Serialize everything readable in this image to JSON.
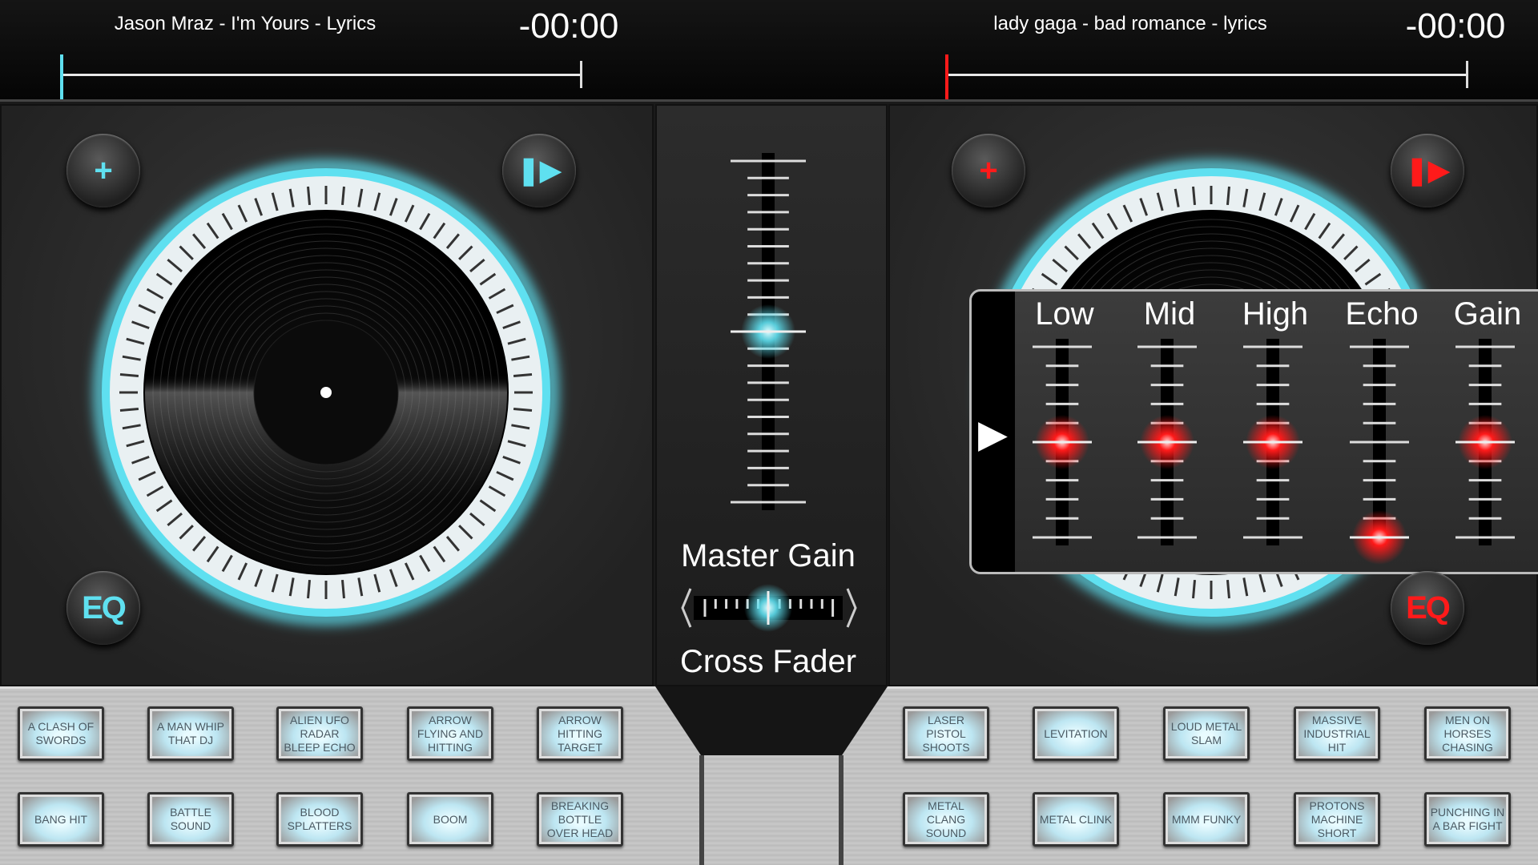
{
  "deck_left": {
    "track_title": "Jason Mraz - I'm Yours - Lyrics",
    "time": "-00:00",
    "progress": 0,
    "accent": "#5fe0f0",
    "add_icon": "plus-icon",
    "play_icon": "play-icon",
    "eq_label": "EQ"
  },
  "deck_right": {
    "track_title": "lady gaga - bad romance - lyrics",
    "time": "-00:00",
    "progress": 0,
    "accent": "#ff1a1a",
    "add_icon": "plus-icon",
    "play_icon": "play-icon",
    "eq_label": "EQ"
  },
  "mixer": {
    "master_gain_label": "Master Gain",
    "master_gain_level": 0.5,
    "cross_fader_label": "Cross Fader",
    "cross_fader_position": 0.5
  },
  "eq_panel": {
    "sliders": [
      {
        "label": "Low",
        "level": 0.5
      },
      {
        "label": "Mid",
        "level": 0.5
      },
      {
        "label": "High",
        "level": 0.5
      },
      {
        "label": "Echo",
        "level": 0
      },
      {
        "label": "Gain",
        "level": 0.5
      }
    ]
  },
  "pads_left": [
    "A CLASH OF SWORDS",
    "A MAN WHIP THAT DJ",
    "ALIEN UFO RADAR BLEEP ECHO",
    "ARROW FLYING AND HITTING",
    "ARROW HITTING TARGET",
    "BANG HIT",
    "BATTLE SOUND",
    "BLOOD SPLATTERS",
    "BOOM",
    "BREAKING BOTTLE OVER HEAD"
  ],
  "pads_right": [
    "LASER PISTOL SHOOTS",
    "LEVITATION",
    "LOUD METAL SLAM",
    "MASSIVE INDUSTRIAL HIT",
    "MEN ON HORSES CHASING",
    "METAL CLANG SOUND",
    "METAL CLINK",
    "MMM FUNKY",
    "PROTONS MACHINE SHORT",
    "PUNCHING IN A BAR FIGHT"
  ]
}
